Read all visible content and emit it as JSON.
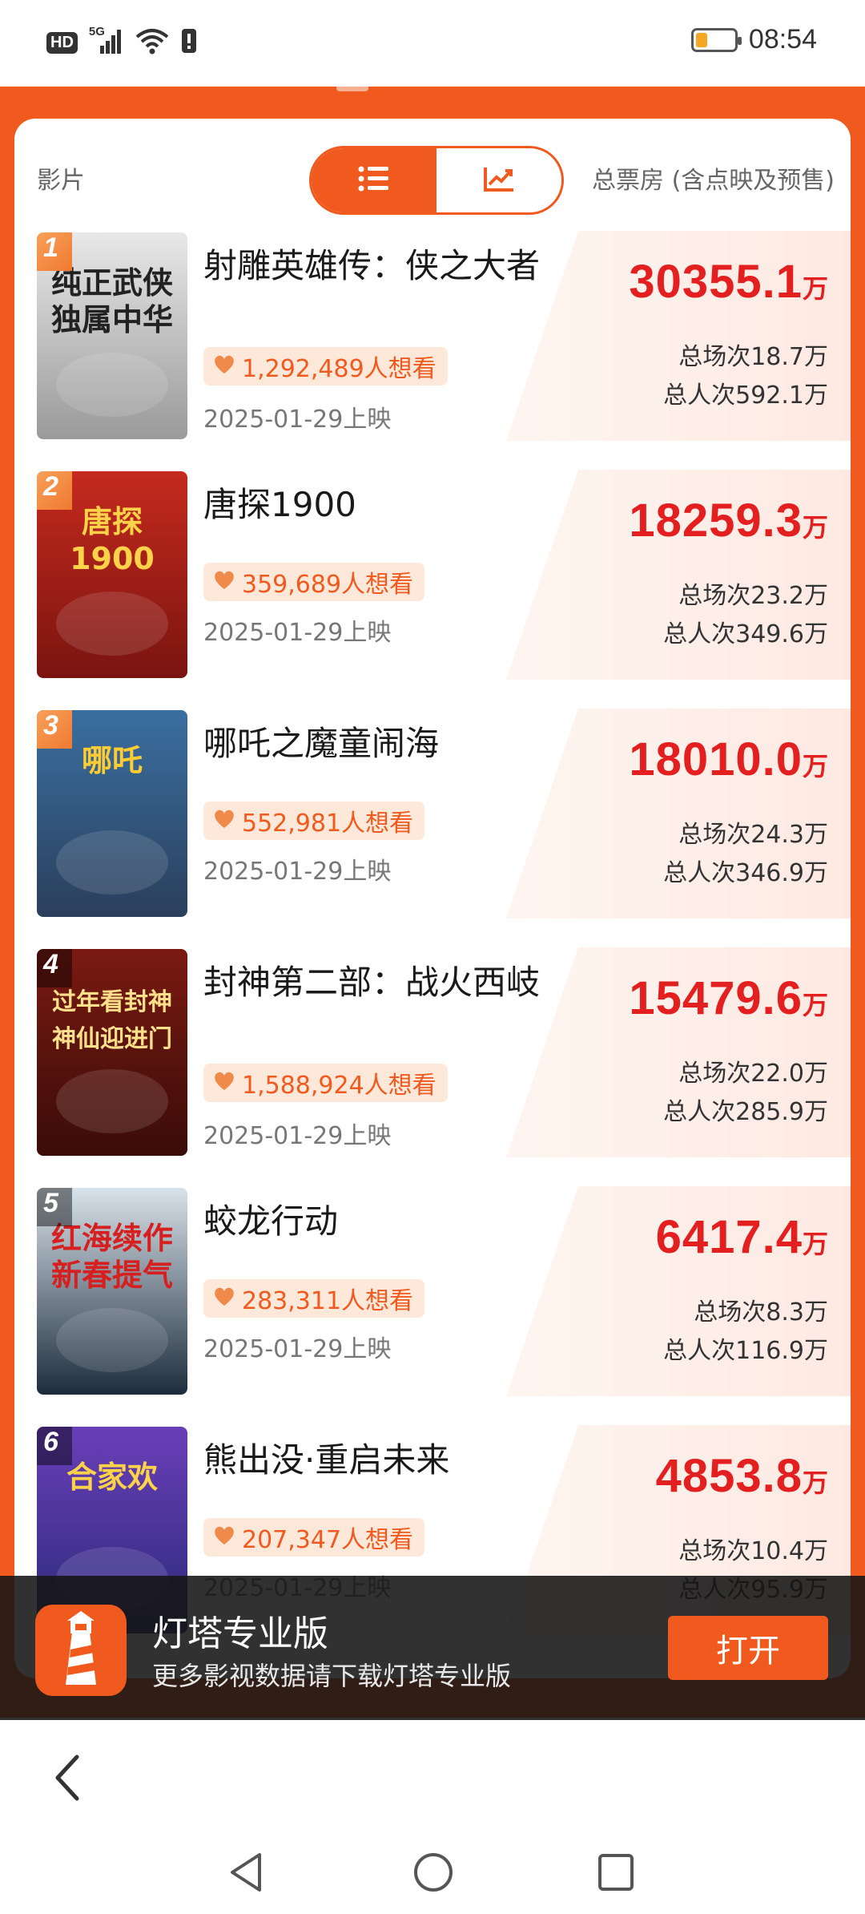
{
  "status_bar": {
    "time": "08:54",
    "network": "5G",
    "hd_label": "HD",
    "icons": [
      "hd-icon",
      "signal-icon",
      "wifi-icon",
      "alert-icon",
      "battery-icon"
    ],
    "battery_fraction": 0.3
  },
  "header": {
    "film_label": "影片",
    "box_label": "总票房 (含点映及预售)",
    "view_toggle": [
      "list-icon",
      "trend-chart-icon"
    ],
    "active_view": "list"
  },
  "movies": [
    {
      "rank": "1",
      "title": "射雕英雄传：侠之大者",
      "want": "1,292,489人想看",
      "release": "2025-01-29上映",
      "box": "30355.1",
      "unit": "万",
      "shows": "总场次18.7万",
      "viewers": "总人次592.1万",
      "poster_text": [
        "纯正武侠",
        "独属中华"
      ],
      "poster_colors": [
        "#e8e8e8",
        "#9a9a9a"
      ],
      "poster_text_color": "#222222"
    },
    {
      "rank": "2",
      "title": "唐探1900",
      "want": "359,689人想看",
      "release": "2025-01-29上映",
      "box": "18259.3",
      "unit": "万",
      "shows": "总场次23.2万",
      "viewers": "总人次349.6万",
      "poster_text": [
        "唐探",
        "1900"
      ],
      "poster_colors": [
        "#c52a1e",
        "#7a1410"
      ],
      "poster_text_color": "#ffd24a"
    },
    {
      "rank": "3",
      "title": "哪吒之魔童闹海",
      "want": "552,981人想看",
      "release": "2025-01-29上映",
      "box": "18010.0",
      "unit": "万",
      "shows": "总场次24.3万",
      "viewers": "总人次346.9万",
      "poster_text": [
        "哪吒",
        ""
      ],
      "poster_colors": [
        "#3a6fa0",
        "#2b3f5c"
      ],
      "poster_text_color": "#ffcc33"
    },
    {
      "rank": "4",
      "title": "封神第二部：战火西岐",
      "want": "1,588,924人想看",
      "release": "2025-01-29上映",
      "box": "15479.6",
      "unit": "万",
      "shows": "总场次22.0万",
      "viewers": "总人次285.9万",
      "poster_text": [
        "过年看封神",
        "神仙迎进门"
      ],
      "poster_colors": [
        "#7a1a12",
        "#3a0c08"
      ],
      "poster_text_color": "#ffe08a"
    },
    {
      "rank": "5",
      "title": "蛟龙行动",
      "want": "283,311人想看",
      "release": "2025-01-29上映",
      "box": "6417.4",
      "unit": "万",
      "shows": "总场次8.3万",
      "viewers": "总人次116.9万",
      "poster_text": [
        "红海续作",
        "新春提气"
      ],
      "poster_colors": [
        "#d8e2ea",
        "#1d2c3c"
      ],
      "poster_text_color": "#d61f1f"
    },
    {
      "rank": "6",
      "title": "熊出没·重启未来",
      "want": "207,347人想看",
      "release": "2025-01-29上映",
      "box": "4853.8",
      "unit": "万",
      "shows": "总场次10.4万",
      "viewers": "总人次95.9万",
      "poster_text": [
        "合家欢",
        ""
      ],
      "poster_colors": [
        "#6a3fb8",
        "#2a2a7a"
      ],
      "poster_text_color": "#ffd24a"
    }
  ],
  "banner": {
    "title": "灯塔专业版",
    "subtitle": "更多影视数据请下载灯塔专业版",
    "open_label": "打开",
    "icon": "lighthouse-icon"
  },
  "nav": {
    "back": "back-arrow-icon",
    "buttons": [
      "nav-back-icon",
      "nav-home-icon",
      "nav-recents-icon"
    ]
  },
  "colors": {
    "accent": "#f05a1e",
    "box_red": "#e41f1f",
    "want_bg": "#fde8d9"
  }
}
